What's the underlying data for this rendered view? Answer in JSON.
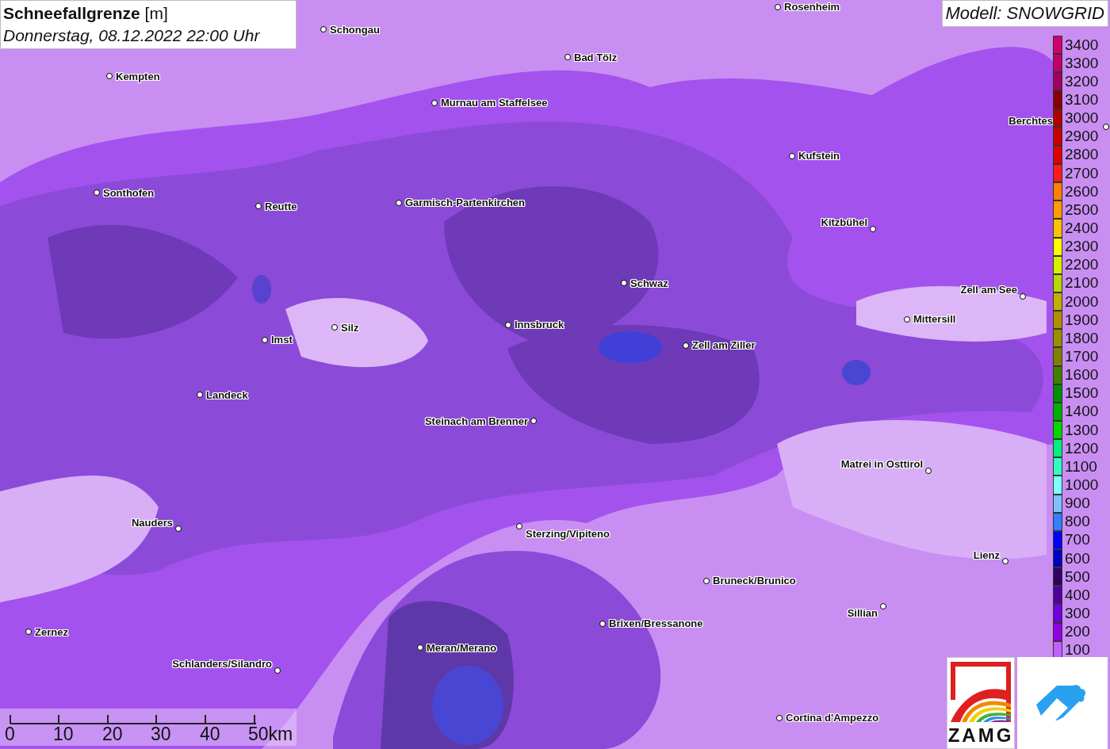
{
  "title": {
    "heading": "**Schneefallgrenze** [m]",
    "subtitle": "Donnerstag, 08.12.2022 22:00 Uhr"
  },
  "model_label": "Modell: SNOWGRID",
  "cities": [
    {
      "name": "Schongau"
    },
    {
      "name": "Rosenheim"
    },
    {
      "name": "Bad Tölz"
    },
    {
      "name": "Kempten"
    },
    {
      "name": "Murnau am Staffelsee"
    },
    {
      "name": "Berchtes"
    },
    {
      "name": "Kufstein"
    },
    {
      "name": "Sonthofen"
    },
    {
      "name": "Reutte"
    },
    {
      "name": "Garmisch-Partenkirchen"
    },
    {
      "name": "Kitzbühel"
    },
    {
      "name": "Schwaz"
    },
    {
      "name": "Zell am See"
    },
    {
      "name": "Mittersill"
    },
    {
      "name": "Innsbruck"
    },
    {
      "name": "Silz"
    },
    {
      "name": "Imst"
    },
    {
      "name": "Zell am Ziller"
    },
    {
      "name": "Landeck"
    },
    {
      "name": "Steinach am Brenner"
    },
    {
      "name": "Matrei in Osttirol"
    },
    {
      "name": "Nauders"
    },
    {
      "name": "Sterzing/Vipiteno"
    },
    {
      "name": "Lienz"
    },
    {
      "name": "Bruneck/Brunico"
    },
    {
      "name": "Sillian"
    },
    {
      "name": "Brixen/Bressanone"
    },
    {
      "name": "Zernez"
    },
    {
      "name": "Meran/Merano"
    },
    {
      "name": "Schlanders/Silandro"
    },
    {
      "name": "Cortina d'Ampezzo"
    }
  ],
  "legend": [
    {
      "label": "3400",
      "color": "#d0006c"
    },
    {
      "label": "3300",
      "color": "#c00068"
    },
    {
      "label": "3200",
      "color": "#a00060"
    },
    {
      "label": "3100",
      "color": "#880000"
    },
    {
      "label": "3000",
      "color": "#b00000"
    },
    {
      "label": "2900",
      "color": "#c80000"
    },
    {
      "label": "2800",
      "color": "#e00000"
    },
    {
      "label": "2700",
      "color": "#ff1c1c"
    },
    {
      "label": "2600",
      "color": "#ff8000"
    },
    {
      "label": "2500",
      "color": "#ff9c00"
    },
    {
      "label": "2400",
      "color": "#ffc000"
    },
    {
      "label": "2300",
      "color": "#ffff00"
    },
    {
      "label": "2200",
      "color": "#d8f000"
    },
    {
      "label": "2100",
      "color": "#b8d800"
    },
    {
      "label": "2000",
      "color": "#c0b000"
    },
    {
      "label": "1900",
      "color": "#b09000"
    },
    {
      "label": "1800",
      "color": "#989000"
    },
    {
      "label": "1700",
      "color": "#808000"
    },
    {
      "label": "1600",
      "color": "#408000"
    },
    {
      "label": "1500",
      "color": "#009000"
    },
    {
      "label": "1400",
      "color": "#00b000"
    },
    {
      "label": "1300",
      "color": "#00d800"
    },
    {
      "label": "1200",
      "color": "#00f080"
    },
    {
      "label": "1100",
      "color": "#30ffc0"
    },
    {
      "label": "1000",
      "color": "#80ffff"
    },
    {
      "label": "900",
      "color": "#80c0ff"
    },
    {
      "label": "800",
      "color": "#3080ff"
    },
    {
      "label": "700",
      "color": "#0000ff"
    },
    {
      "label": "600",
      "color": "#0000c0"
    },
    {
      "label": "500",
      "color": "#300060"
    },
    {
      "label": "400",
      "color": "#5000a0"
    },
    {
      "label": "300",
      "color": "#7000e0"
    },
    {
      "label": "200",
      "color": "#9000e0"
    },
    {
      "label": "100",
      "color": "#c060ff"
    }
  ],
  "scale_bar": {
    "ticks": [
      "0",
      "10",
      "20",
      "30",
      "40",
      "50km"
    ]
  },
  "logos": [
    {
      "kind": "zamg",
      "text": "ZAMG"
    },
    {
      "kind": "cloud"
    }
  ]
}
